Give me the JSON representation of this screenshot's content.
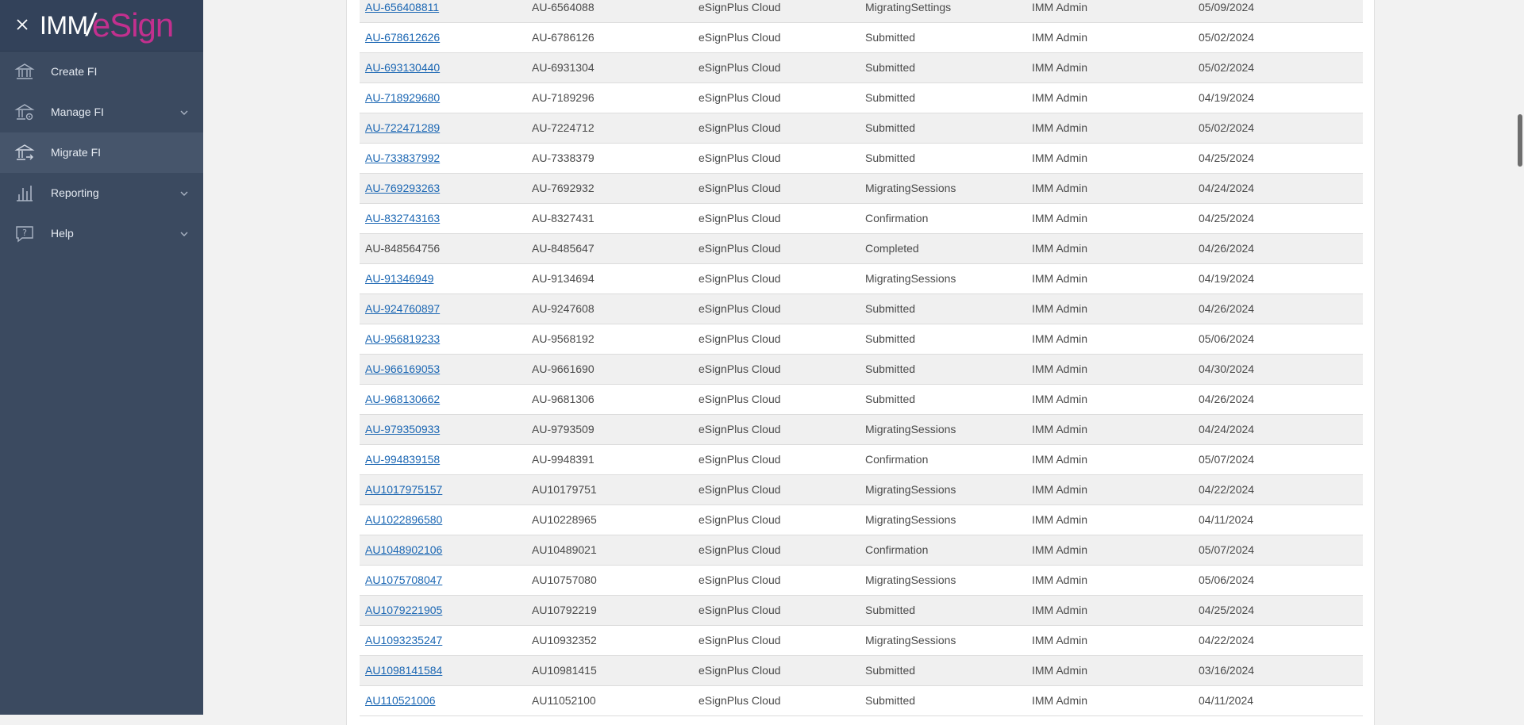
{
  "brand": {
    "logo_imm": "IMM",
    "logo_slash": "/",
    "logo_esign": "eSign"
  },
  "sidebar": {
    "items": [
      {
        "label": "Create FI",
        "icon": "bank-icon"
      },
      {
        "label": "Manage FI",
        "icon": "bank-gear-icon"
      },
      {
        "label": "Migrate FI",
        "icon": "bank-migrate-icon"
      },
      {
        "label": "Reporting",
        "icon": "bar-chart-icon"
      },
      {
        "label": "Help",
        "icon": "help-chat-icon"
      }
    ]
  },
  "table": {
    "rows": [
      [
        "AU-656408811",
        "AU-6564088",
        "eSignPlus Cloud",
        "MigratingSettings",
        "IMM Admin",
        "05/09/2024"
      ],
      [
        "AU-678612626",
        "AU-6786126",
        "eSignPlus Cloud",
        "Submitted",
        "IMM Admin",
        "05/02/2024"
      ],
      [
        "AU-693130440",
        "AU-6931304",
        "eSignPlus Cloud",
        "Submitted",
        "IMM Admin",
        "05/02/2024"
      ],
      [
        "AU-718929680",
        "AU-7189296",
        "eSignPlus Cloud",
        "Submitted",
        "IMM Admin",
        "04/19/2024"
      ],
      [
        "AU-722471289",
        "AU-7224712",
        "eSignPlus Cloud",
        "Submitted",
        "IMM Admin",
        "05/02/2024"
      ],
      [
        "AU-733837992",
        "AU-7338379",
        "eSignPlus Cloud",
        "Submitted",
        "IMM Admin",
        "04/25/2024"
      ],
      [
        "AU-769293263",
        "AU-7692932",
        "eSignPlus Cloud",
        "MigratingSessions",
        "IMM Admin",
        "04/24/2024"
      ],
      [
        "AU-832743163",
        "AU-8327431",
        "eSignPlus Cloud",
        "Confirmation",
        "IMM Admin",
        "04/25/2024"
      ],
      [
        "AU-848564756",
        "AU-8485647",
        "eSignPlus Cloud",
        "Completed",
        "IMM Admin",
        "04/26/2024"
      ],
      [
        "AU-91346949",
        "AU-9134694",
        "eSignPlus Cloud",
        "MigratingSessions",
        "IMM Admin",
        "04/19/2024"
      ],
      [
        "AU-924760897",
        "AU-9247608",
        "eSignPlus Cloud",
        "Submitted",
        "IMM Admin",
        "04/26/2024"
      ],
      [
        "AU-956819233",
        "AU-9568192",
        "eSignPlus Cloud",
        "Submitted",
        "IMM Admin",
        "05/06/2024"
      ],
      [
        "AU-966169053",
        "AU-9661690",
        "eSignPlus Cloud",
        "Submitted",
        "IMM Admin",
        "04/30/2024"
      ],
      [
        "AU-968130662",
        "AU-9681306",
        "eSignPlus Cloud",
        "Submitted",
        "IMM Admin",
        "04/26/2024"
      ],
      [
        "AU-979350933",
        "AU-9793509",
        "eSignPlus Cloud",
        "MigratingSessions",
        "IMM Admin",
        "04/24/2024"
      ],
      [
        "AU-994839158",
        "AU-9948391",
        "eSignPlus Cloud",
        "Confirmation",
        "IMM Admin",
        "05/07/2024"
      ],
      [
        "AU1017975157",
        "AU10179751",
        "eSignPlus Cloud",
        "MigratingSessions",
        "IMM Admin",
        "04/22/2024"
      ],
      [
        "AU1022896580",
        "AU10228965",
        "eSignPlus Cloud",
        "MigratingSessions",
        "IMM Admin",
        "04/11/2024"
      ],
      [
        "AU1048902106",
        "AU10489021",
        "eSignPlus Cloud",
        "Confirmation",
        "IMM Admin",
        "05/07/2024"
      ],
      [
        "AU1075708047",
        "AU10757080",
        "eSignPlus Cloud",
        "MigratingSessions",
        "IMM Admin",
        "05/06/2024"
      ],
      [
        "AU1079221905",
        "AU10792219",
        "eSignPlus Cloud",
        "Submitted",
        "IMM Admin",
        "04/25/2024"
      ],
      [
        "AU1093235247",
        "AU10932352",
        "eSignPlus Cloud",
        "MigratingSessions",
        "IMM Admin",
        "04/22/2024"
      ],
      [
        "AU1098141584",
        "AU10981415",
        "eSignPlus Cloud",
        "Submitted",
        "IMM Admin",
        "03/16/2024"
      ],
      [
        "AU110521006",
        "AU11052100",
        "eSignPlus Cloud",
        "Submitted",
        "IMM Admin",
        "04/11/2024"
      ]
    ],
    "linked": [
      true,
      true,
      true,
      true,
      true,
      true,
      true,
      true,
      false,
      true,
      true,
      true,
      true,
      true,
      true,
      true,
      true,
      true,
      true,
      true,
      true,
      true,
      true,
      true
    ]
  },
  "colors": {
    "sidebar_bg": "#3b4a60",
    "link": "#1a66b3",
    "brand_accent": "#c2308e"
  }
}
